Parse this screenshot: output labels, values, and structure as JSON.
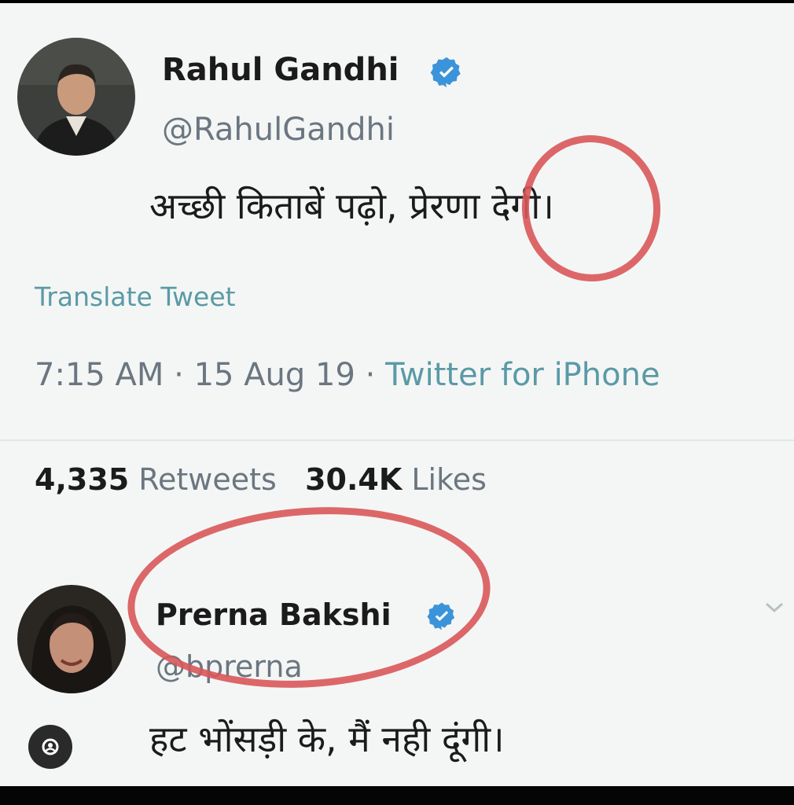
{
  "tweet": {
    "author_name": "Rahul Gandhi",
    "author_handle": "@RahulGandhi",
    "text_before": "अच्छी किताबें पढ़ो,",
    "text_highlight": "प्रेरणा",
    "text_after": "देगी।",
    "translate_label": "Translate Tweet",
    "time": "7:15 AM",
    "date": "15 Aug 19",
    "separator": "·",
    "source": "Twitter for iPhone",
    "retweets_count": "4,335",
    "retweets_label": "Retweets",
    "likes_count": "30.4K",
    "likes_label": "Likes"
  },
  "reply": {
    "author_name": "Prerna Bakshi",
    "author_handle": "@bprerna",
    "text": "हट भोंसड़ी के, मैं नही दूंगी।"
  },
  "icons": {
    "verified": "verified-badge-icon",
    "chevron": "chevron-down-icon",
    "reply_user": "user-circle-icon"
  },
  "colors": {
    "background": "#f4f6f5",
    "text": "#1b1b1b",
    "muted": "#6b7680",
    "link": "#5a9aa6",
    "verified": "#3b94d9",
    "annotation": "#d9585a"
  }
}
